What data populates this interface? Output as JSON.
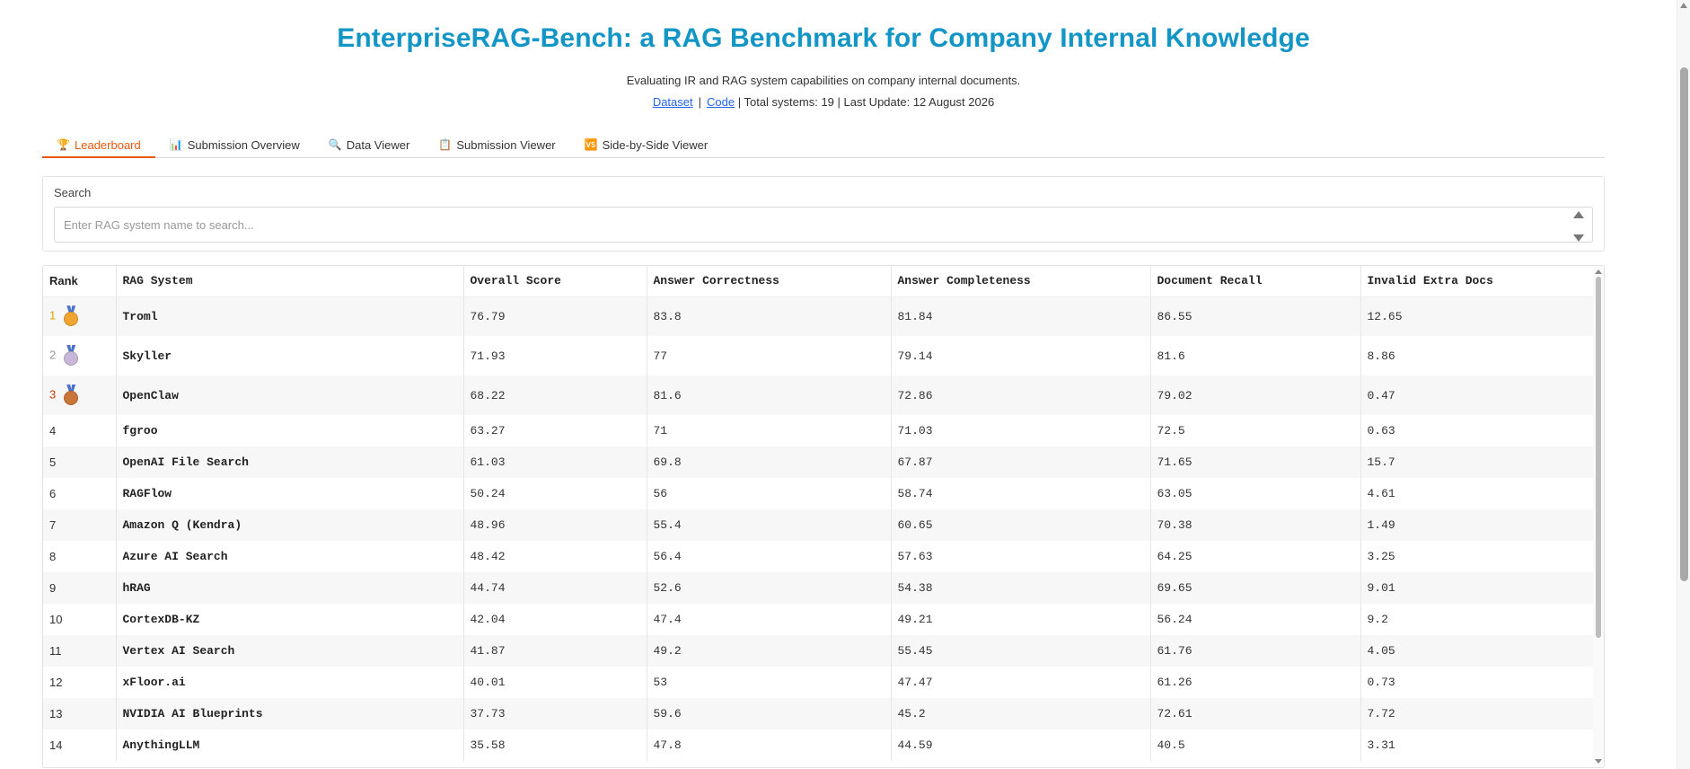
{
  "header": {
    "title": "EnterpriseRAG-Bench: a RAG Benchmark for Company Internal Knowledge",
    "subtitle": "Evaluating IR and RAG system capabilities on company internal documents.",
    "dataset_link": "Dataset",
    "separator": "|",
    "code_link": "Code",
    "stats": "| Total systems: 19 | Last Update: 12 August 2026"
  },
  "tabs": [
    {
      "label": "Leaderboard",
      "icon": "trophy-icon",
      "glyph": "🏆"
    },
    {
      "label": "Submission Overview",
      "icon": "bar-chart-icon",
      "glyph": "📊"
    },
    {
      "label": "Data Viewer",
      "icon": "magnifier-icon",
      "glyph": "🔍"
    },
    {
      "label": "Submission Viewer",
      "icon": "clipboard-icon",
      "glyph": "📋"
    },
    {
      "label": "Side-by-Side Viewer",
      "icon": "compare-icon",
      "glyph": "🆚"
    }
  ],
  "search": {
    "label": "Search",
    "placeholder": "Enter RAG system name to search..."
  },
  "table": {
    "columns": [
      "Rank",
      "RAG System",
      "Overall Score",
      "Answer Correctness",
      "Answer Completeness",
      "Document Recall",
      "Invalid Extra Docs"
    ],
    "rows": [
      [
        "1",
        "Troml",
        "76.79",
        "83.8",
        "81.84",
        "86.55",
        "12.65"
      ],
      [
        "2",
        "Skyller",
        "71.93",
        "77",
        "79.14",
        "81.6",
        "8.86"
      ],
      [
        "3",
        "OpenClaw",
        "68.22",
        "81.6",
        "72.86",
        "79.02",
        "0.47"
      ],
      [
        "4",
        "fgroo",
        "63.27",
        "71",
        "71.03",
        "72.5",
        "0.63"
      ],
      [
        "5",
        "OpenAI File Search",
        "61.03",
        "69.8",
        "67.87",
        "71.65",
        "15.7"
      ],
      [
        "6",
        "RAGFlow",
        "50.24",
        "56",
        "58.74",
        "63.05",
        "4.61"
      ],
      [
        "7",
        "Amazon Q (Kendra)",
        "48.96",
        "55.4",
        "60.65",
        "70.38",
        "1.49"
      ],
      [
        "8",
        "Azure AI Search",
        "48.42",
        "56.4",
        "57.63",
        "64.25",
        "3.25"
      ],
      [
        "9",
        "hRAG",
        "44.74",
        "52.6",
        "54.38",
        "69.65",
        "9.01"
      ],
      [
        "10",
        "CortexDB-KZ",
        "42.04",
        "47.4",
        "49.21",
        "56.24",
        "9.2"
      ],
      [
        "11",
        "Vertex AI Search",
        "41.87",
        "49.2",
        "55.45",
        "61.76",
        "4.05"
      ],
      [
        "12",
        "xFloor.ai",
        "40.01",
        "53",
        "47.47",
        "61.26",
        "0.73"
      ],
      [
        "13",
        "NVIDIA AI Blueprints",
        "37.73",
        "59.6",
        "45.2",
        "72.61",
        "7.72"
      ],
      [
        "14",
        "AnythingLLM",
        "35.58",
        "47.8",
        "44.59",
        "40.5",
        "3.31"
      ]
    ]
  },
  "colors": {
    "title": "#1396c6",
    "active_tab": "#ea580c",
    "link": "#2563eb"
  }
}
